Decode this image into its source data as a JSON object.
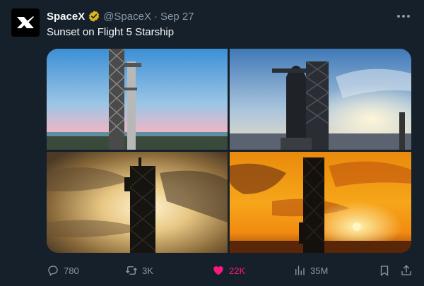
{
  "author": {
    "name": "SpaceX",
    "handle": "@SpaceX",
    "separator": "·",
    "date": "Sep 27",
    "verified": true
  },
  "tweet": {
    "text": "Sunset on Flight 5 Starship"
  },
  "media": {
    "count": 4
  },
  "actions": {
    "replies": "780",
    "retweets": "3K",
    "likes": "22K",
    "views": "35M"
  },
  "colors": {
    "background": "#15202b",
    "text": "#f7f9f9",
    "muted": "#8b98a5",
    "like": "#f91880",
    "verified_badge": "#e2b719"
  },
  "icons": [
    "spacex-logo-icon",
    "verified-badge-icon",
    "more-icon",
    "reply-icon",
    "retweet-icon",
    "like-icon",
    "views-icon",
    "bookmark-icon",
    "share-icon"
  ]
}
